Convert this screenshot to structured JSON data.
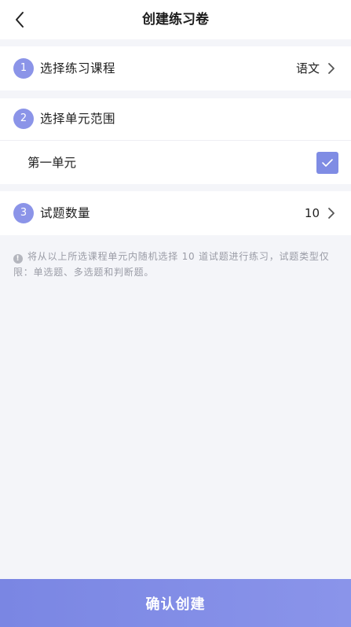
{
  "header": {
    "title": "创建练习卷",
    "back_icon": "chevron-left-icon"
  },
  "course": {
    "step": "1",
    "label": "选择练习课程",
    "value": "语文"
  },
  "unit_scope": {
    "step": "2",
    "label": "选择单元范围",
    "units": [
      {
        "label": "第一单元",
        "checked": true
      }
    ]
  },
  "question_count": {
    "step": "3",
    "label": "试题数量",
    "value": "10"
  },
  "hint": {
    "icon_glyph": "!",
    "text": "将从以上所选课程单元内随机选择 10 道试题进行练习，试题类型仅限：单选题、多选题和判断题。"
  },
  "footer": {
    "confirm_label": "确认创建"
  },
  "colors": {
    "accent": "#8b94e8",
    "checkbox": "#7f8ce4",
    "background": "#f4f5f9"
  }
}
